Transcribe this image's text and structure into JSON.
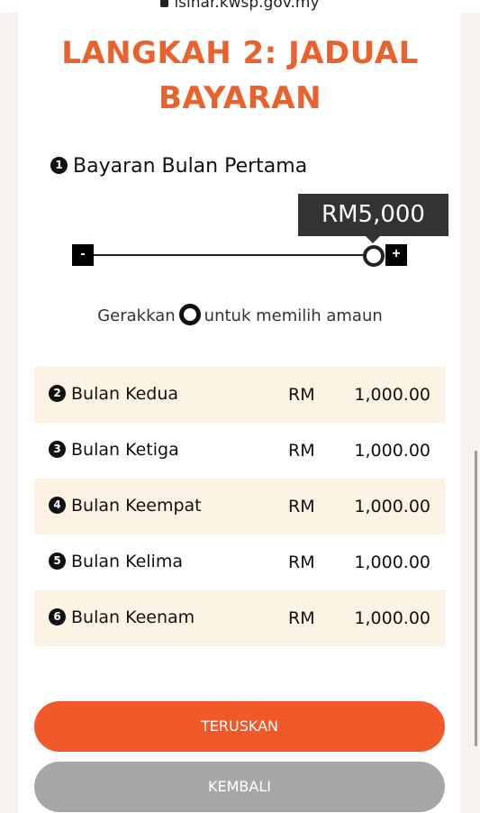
{
  "browser": {
    "url": "isinar.kwsp.gov.my"
  },
  "page": {
    "title_line1": "LANGKAH 2: JADUAL",
    "title_line2": "BAYARAN"
  },
  "first_payment": {
    "step": "1",
    "label": "Bayaran Bulan Pertama",
    "amount": "RM5,000",
    "minus_label": "-",
    "plus_label": "+",
    "slider_level_percent": 97,
    "hint_before": "Gerakkan",
    "hint_after": "untuk memilih amaun"
  },
  "schedule": [
    {
      "step": "2",
      "label": "Bulan Kedua",
      "currency": "RM",
      "amount": "1,000.00"
    },
    {
      "step": "3",
      "label": "Bulan Ketiga",
      "currency": "RM",
      "amount": "1,000.00"
    },
    {
      "step": "4",
      "label": "Bulan Keempat",
      "currency": "RM",
      "amount": "1,000.00"
    },
    {
      "step": "5",
      "label": "Bulan Kelima",
      "currency": "RM",
      "amount": "1,000.00"
    },
    {
      "step": "6",
      "label": "Bulan Keenam",
      "currency": "RM",
      "amount": "1,000.00"
    }
  ],
  "buttons": {
    "next": "TERUSKAN",
    "back": "KEMBALI"
  },
  "colors": {
    "accent": "#e9622d",
    "primary_button": "#f1592a",
    "secondary_button": "#a7a7a7",
    "row_shade": "#fdf3e4"
  }
}
